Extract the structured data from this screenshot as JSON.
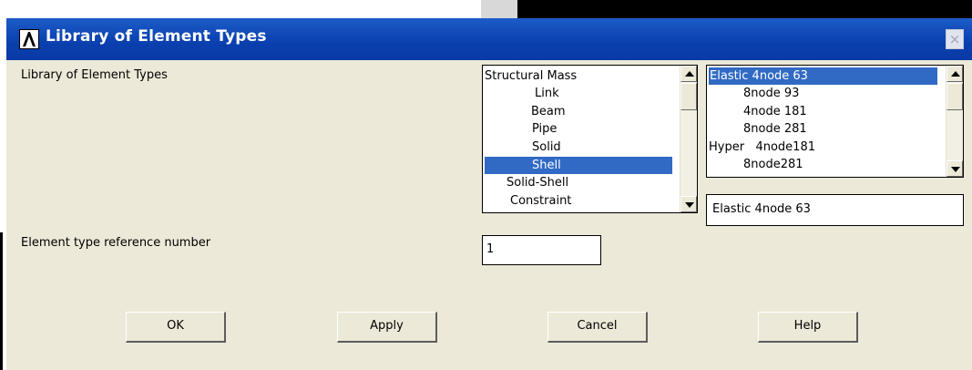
{
  "dialog": {
    "title": "Library of Element Types",
    "close_symbol": "×"
  },
  "labels": {
    "library": "Library of Element Types",
    "ref_number": "Element type reference number"
  },
  "category_list": {
    "items": [
      "Structural Mass",
      "Link",
      "Beam",
      "Pipe",
      "Solid",
      "Shell",
      "Solid-Shell",
      "Constraint"
    ],
    "selected_index": 5
  },
  "element_list": {
    "items": [
      "Elastic 4node 63",
      "8node 93",
      "4node 181",
      "8node 281",
      "Hyper   4node181",
      "8node281"
    ],
    "selected_index": 0
  },
  "selected_element": "Elastic 4node 63",
  "ref_number_value": "1",
  "buttons": {
    "ok": "OK",
    "apply": "Apply",
    "cancel": "Cancel",
    "help": "Help"
  },
  "icons": {
    "app_logo": "ansys-logo-icon",
    "close": "close-icon"
  },
  "colors": {
    "title_bar": "#0a3fae",
    "selection": "#316ac5",
    "dialog_bg": "#ece9d8"
  }
}
